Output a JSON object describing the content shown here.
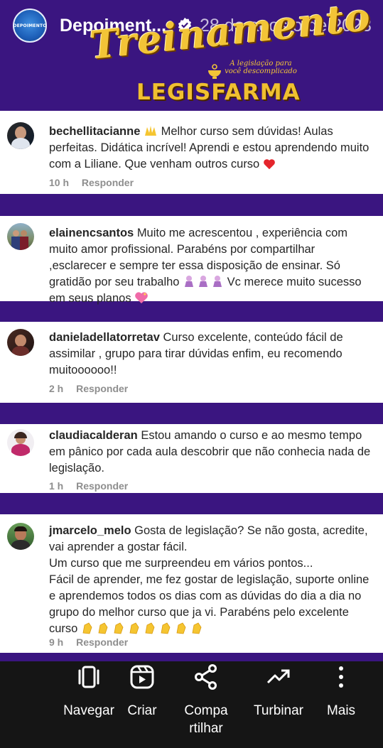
{
  "header": {
    "account_name": "Depoiment...",
    "date": "28 de agosto de 2023",
    "brand_title": "Treinamento",
    "brand_tagline": "A legislação para você descomplicado",
    "brand_subtitle": "LEGISFARMA",
    "logo_text": "DEPOIMENTO"
  },
  "comments": [
    {
      "username": "bechellitacianne",
      "text": "Melhor curso sem dúvidas! Aulas perfeitas. Didática incrível! Aprendi e estou aprendendo muito com a Liliane. Que venham outros curso",
      "time": "10 h",
      "reply": "Responder"
    },
    {
      "username": "elainencsantos",
      "text": "Muito me acrescentou , experiência com muito amor profissional. Parabéns por compartilhar ,esclarecer e sempre ter essa disposição de ensinar. Só gratidão por seu trabalho",
      "text2": "Vc merece muito sucesso em seus planos"
    },
    {
      "username": "danieladellatorretav",
      "text": "Curso excelente, conteúdo fácil de assimilar , grupo para tirar dúvidas enfim, eu recomendo muitoooooo!!",
      "time": "2 h",
      "reply": "Responder"
    },
    {
      "username": "claudiacalderan",
      "text": "Estou amando o curso e ao mesmo tempo em pânico por cada aula descobrir que não conhecia nada de legislação.",
      "time": "1 h",
      "reply": "Responder"
    },
    {
      "username": "jmarcelo_melo",
      "text": "Gosta de legislação? Se não gosta, acredite, vai aprender a gostar fácil.",
      "line2": "Um curso que me surpreendeu em vários pontos...",
      "line3": "Fácil de aprender, me fez gostar de legislação, suporte online e aprendemos todos os dias com as dúvidas do dia a dia no grupo do melhor curso que ja vi. Parabéns pelo excelente curso",
      "time": "9 h",
      "reply": "Responder"
    }
  ],
  "bottom_nav": [
    {
      "label": "Navegar",
      "icon": "browse-icon"
    },
    {
      "label": "Criar",
      "icon": "create-reel-icon"
    },
    {
      "label": "Compa rtilhar",
      "icon": "share-icon"
    },
    {
      "label": "Turbinar",
      "icon": "boost-trend-icon"
    },
    {
      "label": "Mais",
      "icon": "more-vertical-icon"
    }
  ],
  "colors": {
    "background": "#3a1580",
    "brand_gold": "#f2c437",
    "card": "#ffffff",
    "bottom_bar": "#151515"
  }
}
